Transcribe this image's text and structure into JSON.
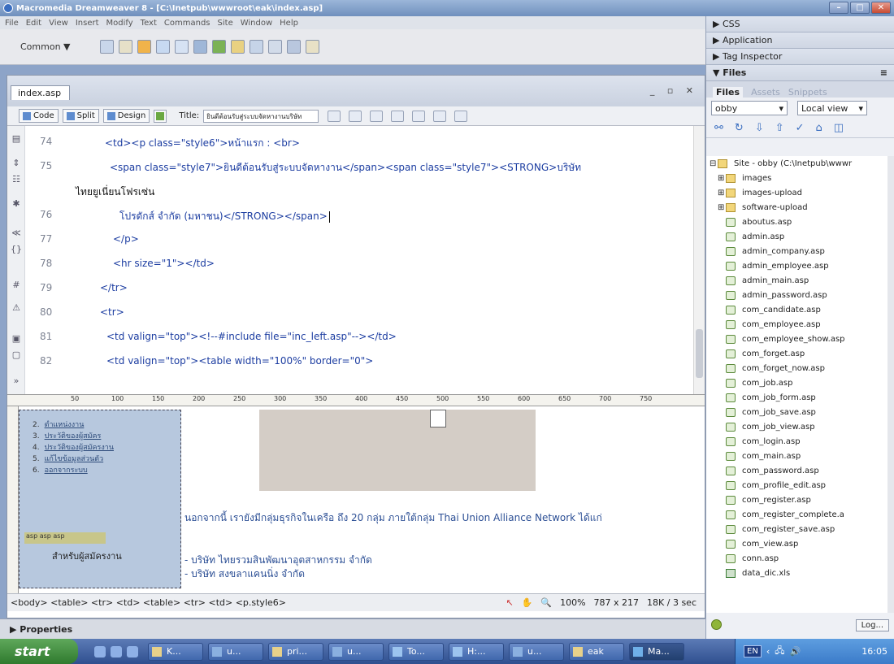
{
  "window": {
    "title": "Macromedia Dreamweaver 8 - [C:\\Inetpub\\wwwroot\\eak\\index.asp]"
  },
  "menu": [
    "File",
    "Edit",
    "View",
    "Insert",
    "Modify",
    "Text",
    "Commands",
    "Site",
    "Window",
    "Help"
  ],
  "insert_bar": {
    "category": "Common ▼"
  },
  "document": {
    "tab": "index.asp",
    "views": {
      "code": "Code",
      "split": "Split",
      "design": "Design"
    },
    "title_label": "Title:",
    "title_value": "ยินดีต้อนรับสู่ระบบจัดหางานบริษัท"
  },
  "code_lines": [
    {
      "n": "74",
      "code": "<td><p class=\"style6\">หน้าแรก : <br>"
    },
    {
      "n": "75",
      "code": "<span class=\"style7\">ยินดีต้อนรับสู่ระบบจัดหางาน</span><span class=\"style7\"><STRONG>บริษัท"
    },
    {
      "n": "",
      "code": "ไทยยูเนี่ยนโฟรเซ่น"
    },
    {
      "n": "76",
      "code": "โปรดักส์ จำกัด (มหาชน)</STRONG></span>"
    },
    {
      "n": "77",
      "code": "</p>"
    },
    {
      "n": "78",
      "code": "<hr size=\"1\"></td>"
    },
    {
      "n": "79",
      "code": "</tr>"
    },
    {
      "n": "80",
      "code": "<tr>"
    },
    {
      "n": "81",
      "code": "<td valign=\"top\"><!--#include file=\"inc_left.asp\"--></td>"
    },
    {
      "n": "82",
      "code": "<td valign=\"top\"><table width=\"100%\"  border=\"0\">"
    }
  ],
  "ruler_marks": [
    "50",
    "100",
    "150",
    "200",
    "250",
    "300",
    "350",
    "400",
    "450",
    "500",
    "550",
    "600",
    "650",
    "700",
    "750"
  ],
  "design": {
    "menu_items": [
      {
        "num": "2.",
        "text": "ตำแหน่งงาน"
      },
      {
        "num": "3.",
        "text": "ประวัติของผู้สมัคร"
      },
      {
        "num": "4.",
        "text": "ประวัติของผู้สมัครงาน"
      },
      {
        "num": "5.",
        "text": "แก้ไขข้อมูลส่วนตัว"
      },
      {
        "num": "6.",
        "text": "ออกจากระบบ"
      }
    ],
    "asp_tags": "asp asp asp",
    "for_applicants": "สำหรับผู้สมัครงาน",
    "group_text": "นอกจากนี้ เรายังมีกลุ่มธุรกิจในเครือ ถึง 20 กลุ่ม ภายใต้กลุ่ม Thai Union Alliance Network ได้แก่",
    "company_1": "- บริษัท ไทยรวมสินพัฒนาอุตสาหกรรม จำกัด",
    "company_2": "- บริษัท สงขลาแคนนิ่ง จำกัด"
  },
  "status_bar": {
    "tags": "<body> <table> <tr> <td> <table> <tr> <td> <p.style6>",
    "zoom": "100%",
    "size": "787 x 217",
    "weight": "18K / 3 sec"
  },
  "properties_label": "▶ Properties",
  "right_panel": {
    "groups": [
      "▶ CSS",
      "▶ Application",
      "▶ Tag Inspector"
    ],
    "files_header": "▼ Files",
    "tabs": [
      "Files",
      "Assets",
      "Snippets"
    ],
    "site_select": "obby",
    "view_select": "Local view",
    "root": "Site - obby (C:\\Inetpub\\wwwr",
    "folders": [
      "images",
      "images-upload",
      "software-upload"
    ],
    "files": [
      "aboutus.asp",
      "admin.asp",
      "admin_company.asp",
      "admin_employee.asp",
      "admin_main.asp",
      "admin_password.asp",
      "com_candidate.asp",
      "com_employee.asp",
      "com_employee_show.asp",
      "com_forget.asp",
      "com_forget_now.asp",
      "com_job.asp",
      "com_job_form.asp",
      "com_job_save.asp",
      "com_job_view.asp",
      "com_login.asp",
      "com_main.asp",
      "com_password.asp",
      "com_profile_edit.asp",
      "com_register.asp",
      "com_register_complete.a",
      "com_register_save.asp",
      "com_view.asp",
      "conn.asp",
      "data_dic.xls"
    ],
    "log_button": "Log..."
  },
  "taskbar": {
    "start": "start",
    "items": [
      "K...",
      "u...",
      "pri...",
      "u...",
      "To...",
      "H:...",
      "u...",
      "eak",
      "Ma..."
    ],
    "lang": "EN",
    "time": "16:05"
  }
}
